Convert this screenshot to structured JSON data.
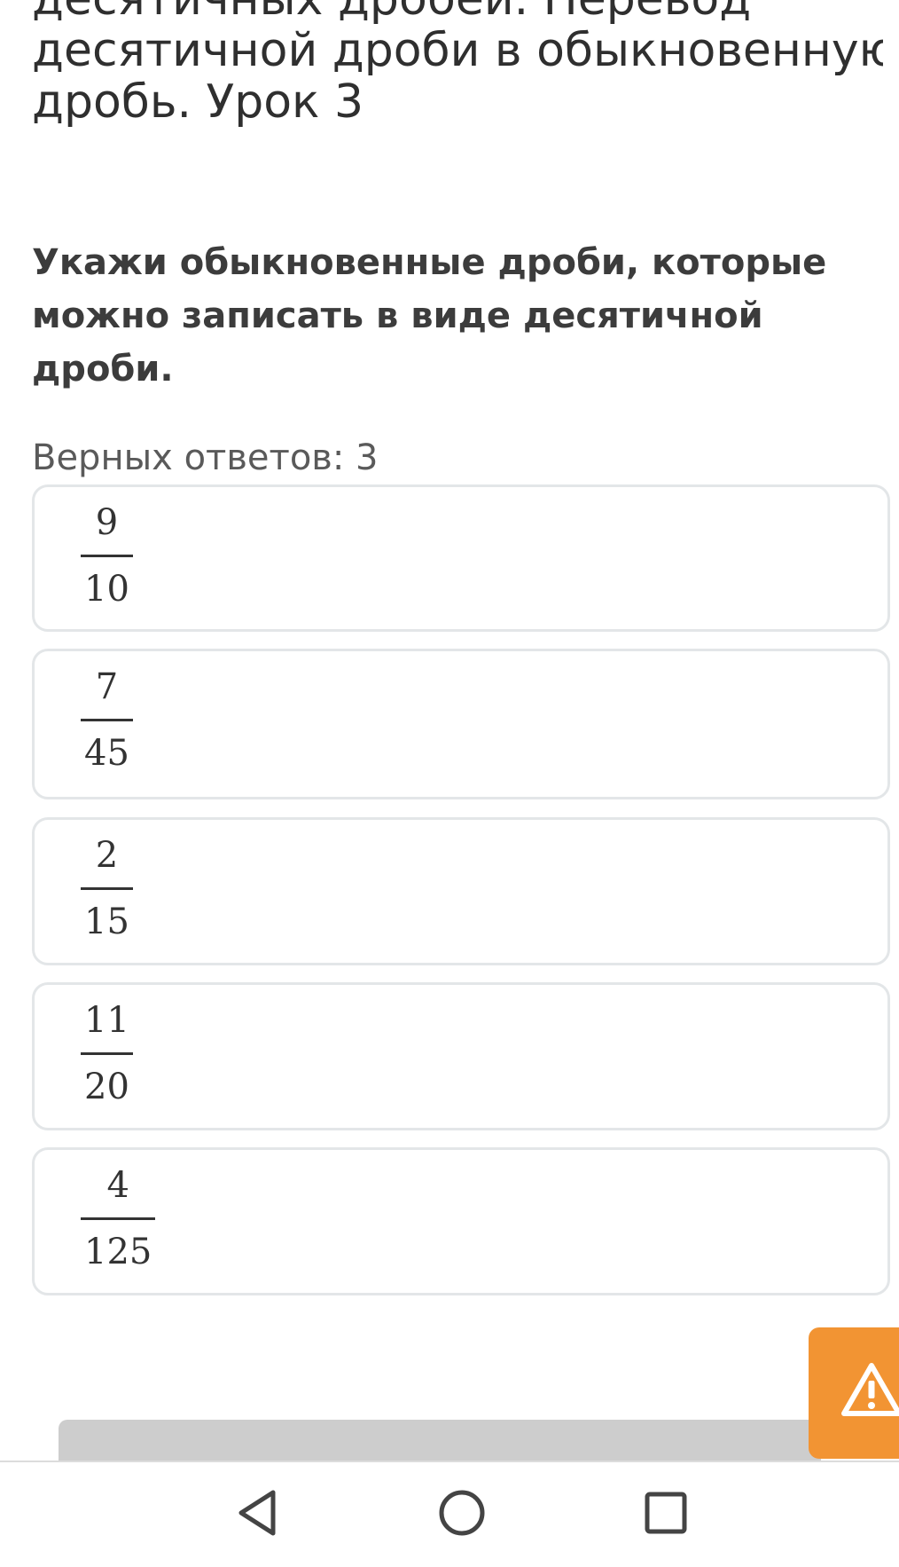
{
  "lesson": {
    "title_lines": [
      "десятичных дробей. Перевод",
      "десятичной дроби в обыкновенную",
      "дробь. Урок 3"
    ]
  },
  "question": {
    "text": "Укажи обыкновенные дроби, которые можно записать в виде десятичной дроби.",
    "answers_count": "Верных ответов: 3"
  },
  "options": [
    {
      "numerator": "9",
      "denominator": "10"
    },
    {
      "numerator": "7",
      "denominator": "45"
    },
    {
      "numerator": "2",
      "denominator": "15"
    },
    {
      "numerator": "11",
      "denominator": "20"
    },
    {
      "numerator": "4",
      "denominator": "125"
    }
  ],
  "colors": {
    "warning_button": "#f29433",
    "option_border": "#e3e6e8",
    "bottom_button": "#cdcdcd"
  },
  "icons": {
    "report": "warning-triangle-icon",
    "nav_back": "back-triangle-icon",
    "nav_home": "home-circle-icon",
    "nav_recents": "recents-square-icon"
  }
}
